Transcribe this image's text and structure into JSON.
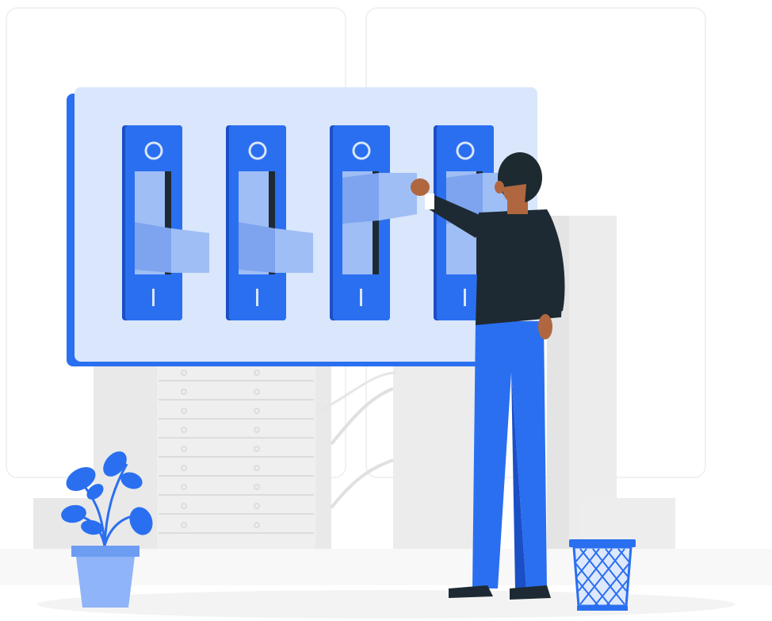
{
  "illustration": {
    "subject": "person-flipping-breaker-switches",
    "palette": {
      "accent": "#2a6ff0",
      "accent_dark": "#1b4fc6",
      "accent_light": "#8fb4f7",
      "panel_bg": "#d9e6fb",
      "handle_light": "#9fbef5",
      "handle_mid": "#7ea4ef",
      "handle_dark": "#1e2a33",
      "server_gray": "#e6e6e6",
      "server_line": "#d2d2d2",
      "skin": "#b0673f",
      "hair": "#1d2a30",
      "floor": "#f2f2f2"
    },
    "switches": [
      {
        "name": "switch-1",
        "state": "down"
      },
      {
        "name": "switch-2",
        "state": "down"
      },
      {
        "name": "switch-3",
        "state": "up"
      },
      {
        "name": "switch-4",
        "state": "up"
      }
    ],
    "switch_symbols": {
      "top": "O",
      "bottom": "I"
    }
  }
}
